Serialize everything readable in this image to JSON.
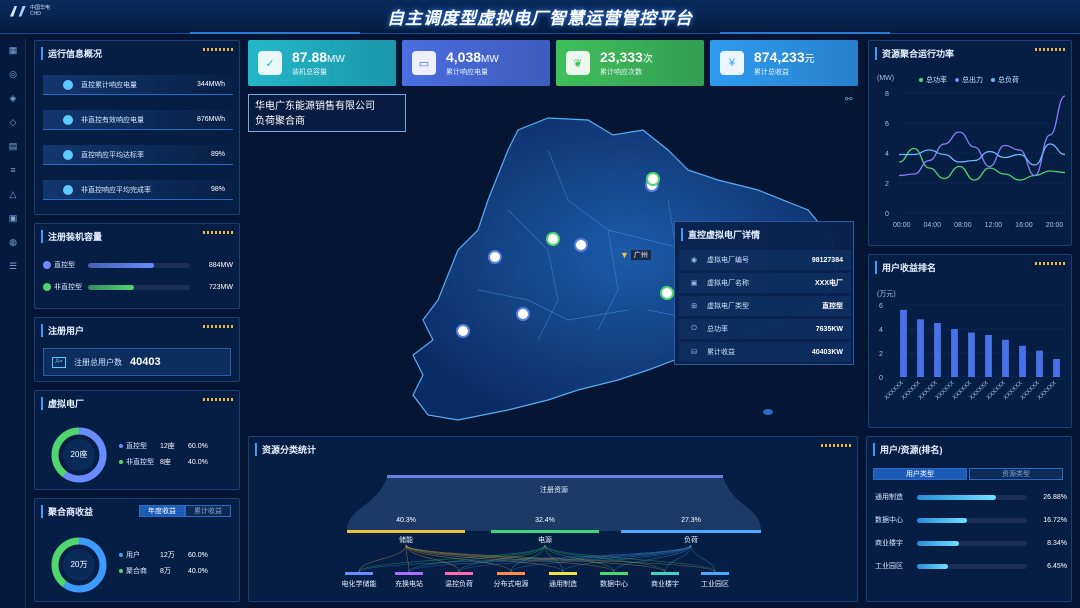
{
  "header": {
    "title": "自主调度型虚拟电厂智慧运营管控平台",
    "logo_line1": "中国华电",
    "logo_line2": "CHD"
  },
  "sidebar": {
    "icons": [
      "dashboard-icon",
      "monitor-icon",
      "cube-icon",
      "layers-icon",
      "list-icon",
      "stack-icon",
      "recycle-icon",
      "grid-icon",
      "lock-icon",
      "sliders-icon"
    ]
  },
  "ops": {
    "title": "运行信息概况",
    "items": [
      {
        "label": "直控累计响应电量",
        "value": "344MWh"
      },
      {
        "label": "非直控有效响应电量",
        "value": "876MWh"
      },
      {
        "label": "直控响应平均达标率",
        "value": "89%"
      },
      {
        "label": "非直控响应平均完成率",
        "value": "98%"
      }
    ]
  },
  "capacity": {
    "title": "注册装机容量",
    "items": [
      {
        "label": "直控型",
        "value": "884MW",
        "fraction": 0.65,
        "color": "#6b8cff"
      },
      {
        "label": "非直控型",
        "value": "723MW",
        "fraction": 0.45,
        "color": "#4fd66e"
      }
    ]
  },
  "users": {
    "title": "注册用户",
    "label": "注册总用户数",
    "value": "40403"
  },
  "vpp": {
    "title": "虚拟电厂",
    "center": "20座",
    "items": [
      {
        "label": "直控型",
        "count": "12座",
        "pct": "60.0%",
        "color": "#6b8cff"
      },
      {
        "label": "非直控型",
        "count": "8座",
        "pct": "40.0%",
        "color": "#4fd66e"
      }
    ]
  },
  "agg": {
    "title": "聚合商收益",
    "tabs": [
      "年度收益",
      "累计收益"
    ],
    "center": "20万",
    "items": [
      {
        "label": "用户",
        "count": "12万",
        "pct": "60.0%",
        "color": "#3d9bff"
      },
      {
        "label": "聚合商",
        "count": "8万",
        "pct": "40.0%",
        "color": "#4fd66e"
      }
    ]
  },
  "kpis": [
    {
      "value": "87.88",
      "unit": "MW",
      "label": "装机总容量",
      "color": "#22b7c8",
      "icon": "document-icon"
    },
    {
      "value": "4,038",
      "unit": "MW",
      "label": "累计响应电量",
      "color": "#4b6ee0",
      "icon": "picture-icon"
    },
    {
      "value": "23,333",
      "unit": "次",
      "label": "累计响应次数",
      "color": "#3fbf5a",
      "icon": "leaf-icon"
    },
    {
      "value": "874,233",
      "unit": "元",
      "label": "累计总收益",
      "color": "#2f9bf0",
      "icon": "moneybag-icon"
    }
  ],
  "map": {
    "company_line1": "华电广东能源销售有限公司",
    "company_line2": "负荷聚合商",
    "city": "广州",
    "detail": {
      "title": "直控虚拟电厂详情",
      "rows": [
        {
          "label": "虚拟电厂编号",
          "value": "98127384",
          "icon": "id-icon"
        },
        {
          "label": "虚拟电厂名称",
          "value": "XXX电厂",
          "icon": "card-icon"
        },
        {
          "label": "虚拟电厂类型",
          "value": "直控型",
          "icon": "grid-icon"
        },
        {
          "label": "总功率",
          "value": "7635KW",
          "icon": "power-icon"
        },
        {
          "label": "累计收益",
          "value": "40403KW",
          "icon": "money-icon"
        }
      ]
    }
  },
  "sankey": {
    "title": "资源分类统计",
    "root": "注册资源",
    "groups": [
      {
        "label": "储能",
        "pct": "40.3%",
        "color": "#f0c23d"
      },
      {
        "label": "电源",
        "pct": "32.4%",
        "color": "#3fd67a"
      },
      {
        "label": "负荷",
        "pct": "27.3%",
        "color": "#4aa8ff"
      }
    ],
    "leaves": [
      {
        "label": "电化学储能",
        "color": "#6b8cff"
      },
      {
        "label": "充换电站",
        "color": "#b06bff"
      },
      {
        "label": "温控负荷",
        "color": "#ff6bb0"
      },
      {
        "label": "分布式电源",
        "color": "#ff8a4a"
      },
      {
        "label": "通用制造",
        "color": "#f0e04a"
      },
      {
        "label": "数据中心",
        "color": "#4fd66e"
      },
      {
        "label": "商业楼宇",
        "color": "#3fd6c8"
      },
      {
        "label": "工业园区",
        "color": "#4aa8ff"
      }
    ]
  },
  "power_chart": {
    "title": "资源聚合运行功率",
    "chart_data": {
      "type": "line",
      "ylabel": "(MW)",
      "ylim": [
        0,
        8
      ],
      "yticks": [
        "0",
        "2",
        "4",
        "6",
        "8"
      ],
      "categories": [
        "00:00",
        "04:00",
        "08:00",
        "12:00",
        "16:00",
        "20:00"
      ],
      "series": [
        {
          "name": "总功率",
          "color": "#4fd66e",
          "values": [
            3.4,
            4.3,
            3.0,
            2.3,
            3.1,
            2.2,
            3.0,
            2.6,
            2.2,
            2.5,
            2.8,
            2.7
          ]
        },
        {
          "name": "总出力",
          "color": "#8a7dff",
          "values": [
            2.5,
            2.6,
            3.5,
            4.6,
            5.4,
            4.4,
            3.1,
            4.5,
            4.2,
            2.5,
            5.2,
            7.8
          ]
        },
        {
          "name": "总负荷",
          "color": "#6fb6ff",
          "values": [
            3.9,
            3.9,
            4.2,
            3.9,
            3.4,
            3.5,
            4.1,
            3.7,
            3.9,
            3.2,
            4.6,
            3.9
          ]
        }
      ]
    }
  },
  "ranking_chart": {
    "title": "用户收益排名",
    "chart_data": {
      "type": "bar",
      "ylabel": "(万元)",
      "ylim": [
        0,
        6
      ],
      "yticks": [
        "0",
        "2",
        "4",
        "6"
      ],
      "categories": [
        "XXXXXX",
        "XXXXXX",
        "XXXXXX",
        "XXXXXX",
        "XXXXXX",
        "XXXXXX",
        "XXXXXX",
        "XXXXXX",
        "XXXXXX",
        "XXXXXX"
      ],
      "values": [
        5.6,
        4.8,
        4.5,
        4.0,
        3.7,
        3.5,
        3.1,
        2.6,
        2.2,
        1.5
      ]
    }
  },
  "user_rank": {
    "title": "用户/资源(排名)",
    "tabs": [
      "用户类型",
      "资源类型"
    ],
    "items": [
      {
        "label": "通用制造",
        "pct": "26.88%",
        "fraction": 0.72
      },
      {
        "label": "数据中心",
        "pct": "16.72%",
        "fraction": 0.45
      },
      {
        "label": "商业楼宇",
        "pct": "8.34%",
        "fraction": 0.38
      },
      {
        "label": "工业园区",
        "pct": "6.45%",
        "fraction": 0.28
      }
    ]
  }
}
